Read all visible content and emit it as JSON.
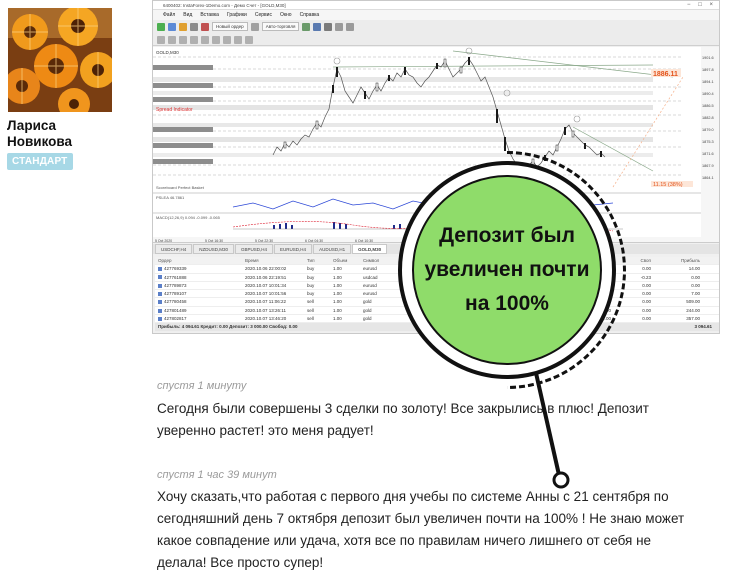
{
  "profile": {
    "name": "Лариса Новикова",
    "badge": "СТАНДАРТ"
  },
  "terminal": {
    "window_title": "6400402: InstaForex-1Demo.com - Демо Счет - [GOLD,M30]",
    "menu": [
      "Файл",
      "Вид",
      "Вставка",
      "Графики",
      "Сервис",
      "Окно",
      "Справка"
    ],
    "toolbar": {
      "new_order": "Новый ордер",
      "auto_trading": "Авто-торговля"
    },
    "chart": {
      "symbol_label": "GOLD,M30",
      "price_callout": "1886.11",
      "indicator_label": "Spread Indicator",
      "percent_label": "11.15 (38%)",
      "indicator_line1": "PSLEA 46.7861",
      "indicator_line2": "MACD(12,26,9) 0.094 -0.099 -0.065",
      "indicator_line3": "Scoreboard Perfect Basket",
      "price_axis": [
        "1901.6",
        "1897.8",
        "1894.1",
        "1890.4",
        "1886.5",
        "1882.8",
        "1879.0",
        "1875.3",
        "1871.6",
        "1867.9",
        "1864.1"
      ],
      "time_axis": [
        "5 Oct 2020",
        "5 Oct 16:30",
        "5 Oct 22:30",
        "6 Oct 04:30",
        "6 Oct 10:30",
        "6 Oct 16:30",
        "6 Oct 22:30",
        "7 Oct 04:30",
        "7 Oct 10:30"
      ]
    },
    "symbol_tabs": [
      "USDCHF,H4",
      "NZDUSD,M30",
      "GBPUSD,H4",
      "EURUSD,H4",
      "AUDUSD,H1",
      "GOLD,M30"
    ],
    "table": {
      "headers": {
        "order": "Ордер",
        "time": "Время",
        "type": "Тип",
        "volume": "Объем",
        "symbol": "Символ",
        "commission": "Комиссия",
        "swap": "Своп",
        "profit": "Прибыль"
      },
      "rows": [
        {
          "order": "427769339",
          "time": "2020.10.06 22:00:02",
          "type": "buy",
          "volume": "1.00",
          "symbol": "eurusd",
          "rest": "",
          "commission": "0.00",
          "swap": "0.00",
          "profit": "14.00"
        },
        {
          "order": "427761888",
          "time": "2020.10.06 22:19:51",
          "type": "buy",
          "volume": "1.00",
          "symbol": "usdcad",
          "rest": "",
          "commission": "0.00",
          "swap": "-0.23",
          "profit": "0.00"
        },
        {
          "order": "427789873",
          "time": "2020.10.07 10:01:34",
          "type": "buy",
          "volume": "1.00",
          "symbol": "eurusd",
          "rest": "",
          "commission": "0.00",
          "swap": "0.00",
          "profit": "0.00"
        },
        {
          "order": "427789107",
          "time": "2020.10.07 10:01:56",
          "type": "buy",
          "volume": "1.00",
          "symbol": "eurusd",
          "rest": "",
          "commission": "0.00",
          "swap": "0.00",
          "profit": "7.00"
        },
        {
          "order": "427780458",
          "time": "2020.10.07 11:06:22",
          "type": "sell",
          "volume": "1.00",
          "symbol": "gold",
          "rest": "1897.",
          "commission": "0.00",
          "swap": "0.00",
          "profit": "509.00"
        },
        {
          "order": "427801489",
          "time": "2020.10.07 13:26:11",
          "type": "sell",
          "volume": "1.00",
          "symbol": "gold",
          "rest": "1895.",
          "commission": "0.00",
          "swap": "0.00",
          "profit": "244.00"
        },
        {
          "order": "427802817",
          "time": "2020.10.07 13:46:20",
          "type": "sell",
          "volume": "1.00",
          "symbol": "gold",
          "rest": "1893.",
          "commission": "0.00",
          "swap": "0.00",
          "profit": "357.00"
        }
      ],
      "total_label": "Прибыль: 4 094.61  Кредит: 0.00  Депозит: 3 000.00  Свобод: 0.00",
      "total_profit": "3 094.61"
    }
  },
  "callout": {
    "text": "Депозит был увеличен почти на 100%"
  },
  "comments": [
    {
      "time": "спустя 1 минуту",
      "text_line1": "Сегодня были совершены 3 сделки по золоту! Все закрылись в плюс! Депозит",
      "text_line2": "уверенно растет! это меня радует!"
    },
    {
      "time": "спустя 1 час 39 минут",
      "text_line1": "Хочу сказать,что работая с первого дня учебы по системе Анны с 21 сентября по",
      "text_line2": "сегодняшний день 7 октября депозит был увеличен почти на 100% ! Не знаю может",
      "text_line3": "какое совпадение или удача, хотя все по правилам ничего лишнего от себя не",
      "text_line4": "делала! Все просто супер!"
    }
  ]
}
